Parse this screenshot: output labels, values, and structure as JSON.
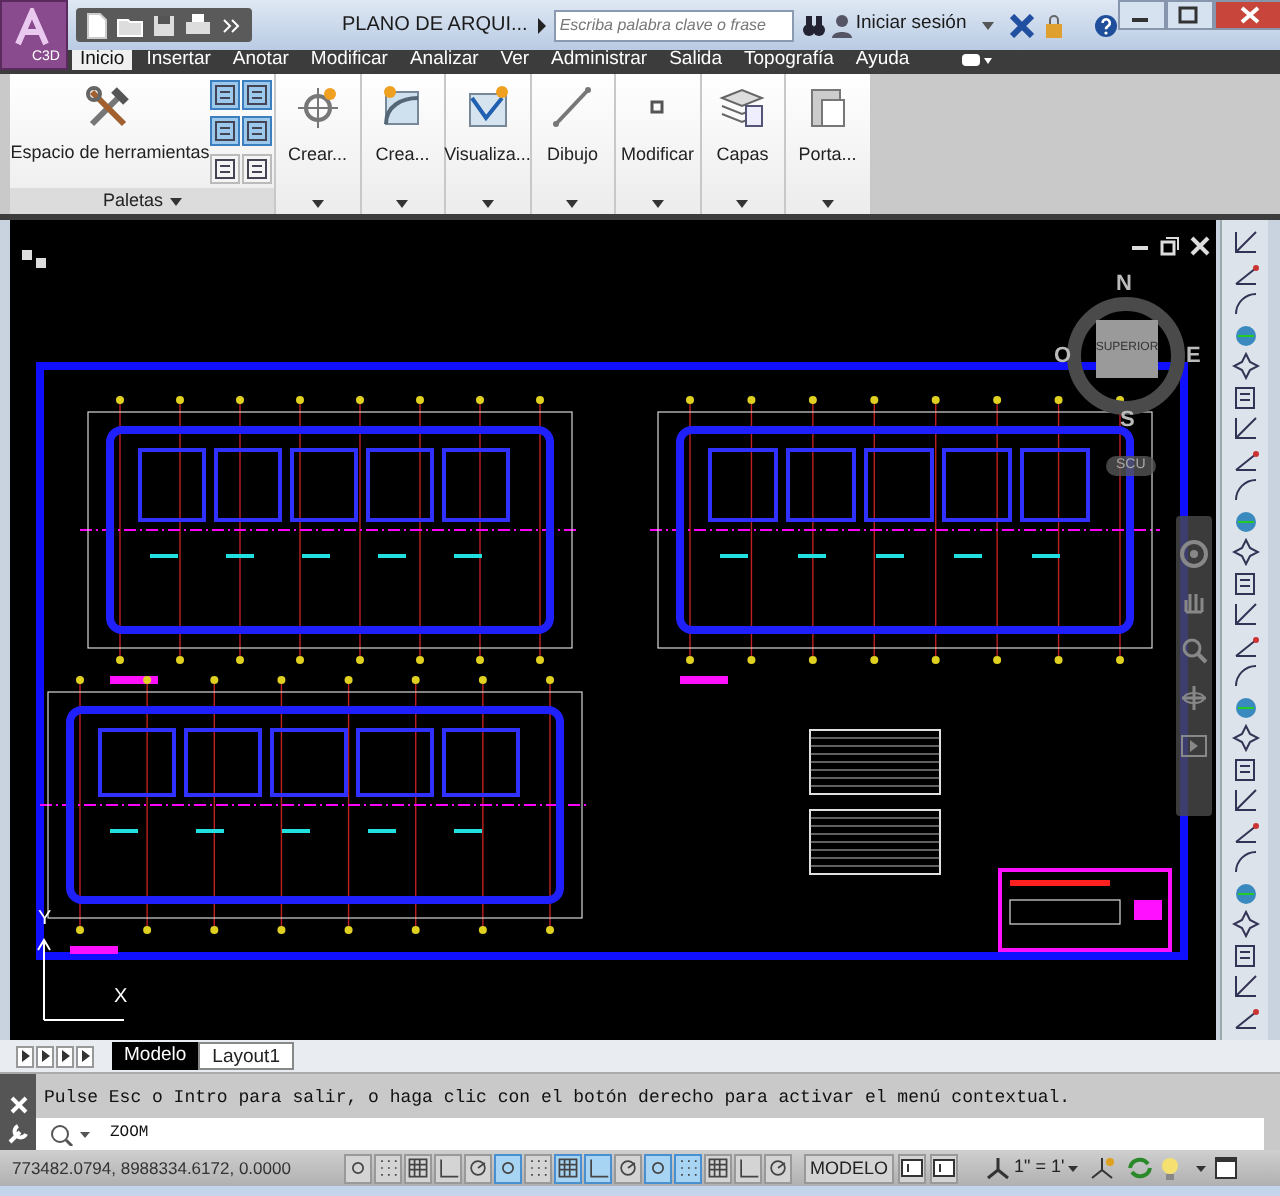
{
  "window": {
    "title": "PLANO DE ARQUI..."
  },
  "app_button": {
    "label": "C3D"
  },
  "search": {
    "placeholder": "Escriba palabra clave o frase"
  },
  "user": {
    "label": "Iniciar sesión"
  },
  "tabs": [
    {
      "label": "Inicio",
      "selected": true
    },
    {
      "label": "Insertar",
      "selected": false
    },
    {
      "label": "Anotar",
      "selected": false
    },
    {
      "label": "Modificar",
      "selected": false
    },
    {
      "label": "Analizar",
      "selected": false
    },
    {
      "label": "Ver",
      "selected": false
    },
    {
      "label": "Administrar",
      "selected": false
    },
    {
      "label": "Salida",
      "selected": false
    },
    {
      "label": "Topografía",
      "selected": false
    },
    {
      "label": "Ayuda",
      "selected": false
    }
  ],
  "ribbon": {
    "tools_button": {
      "label": "Espacio de herramientas"
    },
    "palettes": {
      "label": "Paletas",
      "buttons": [
        {
          "on": true
        },
        {
          "on": true
        },
        {
          "on": true
        },
        {
          "on": true
        },
        {
          "on": false
        },
        {
          "on": false
        }
      ]
    },
    "panels": [
      {
        "label": "Crear..."
      },
      {
        "label": "Crea..."
      },
      {
        "label": "Visualiza..."
      },
      {
        "label": "Dibujo"
      },
      {
        "label": "Modificar"
      },
      {
        "label": "Capas"
      },
      {
        "label": "Porta..."
      }
    ]
  },
  "viewcube": {
    "north": "N",
    "west": "O",
    "east": "E",
    "south": "S",
    "face": "SUPERIOR",
    "ucs": "SCU"
  },
  "ucs_icon": {
    "y": "Y",
    "x": "X"
  },
  "layout_tabs": [
    {
      "label": "Modelo",
      "selected": true
    },
    {
      "label": "Layout1",
      "selected": false
    }
  ],
  "command": {
    "history": "Pulse Esc o Intro para salir, o haga clic con el botón derecho para activar el menú contextual.",
    "prompt": "ZOOM"
  },
  "status_bar": {
    "coordinates": "773482.0794, 8988334.6172, 0.0000",
    "toggles": [
      {
        "on": false
      },
      {
        "on": false
      },
      {
        "on": false
      },
      {
        "on": false
      },
      {
        "on": false
      },
      {
        "on": true
      },
      {
        "on": false
      },
      {
        "on": true
      },
      {
        "on": true
      },
      {
        "on": false
      },
      {
        "on": true
      },
      {
        "on": true
      },
      {
        "on": false
      },
      {
        "on": false
      },
      {
        "on": false
      }
    ],
    "space": "MODELO",
    "scale": "1\" = 1'"
  }
}
